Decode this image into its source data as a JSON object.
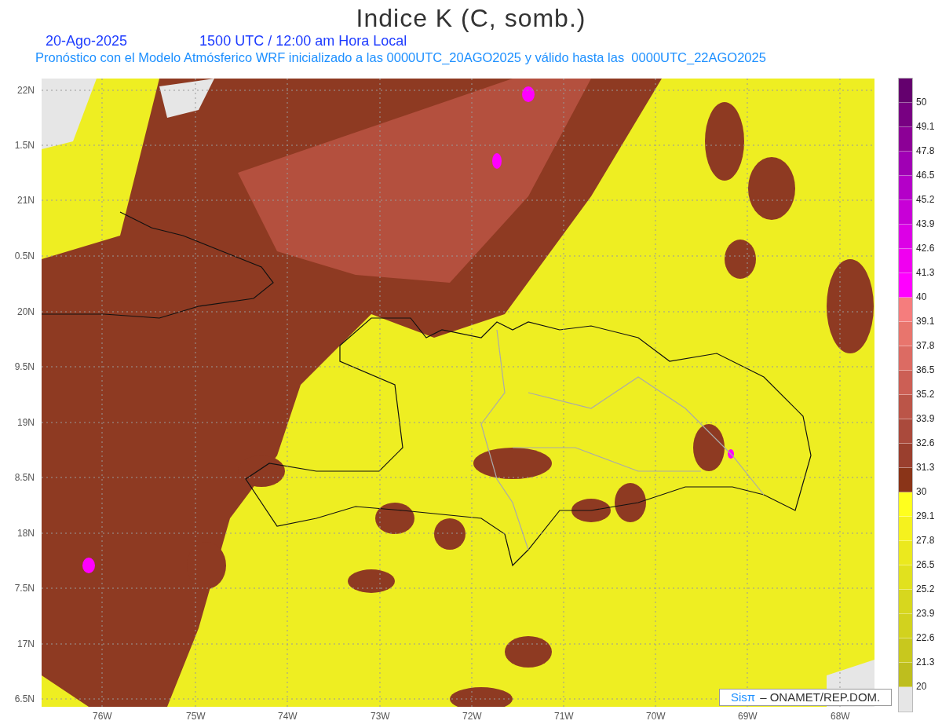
{
  "title": "Indice K (C, somb.)",
  "date": "20-Ago-2025",
  "time": "1500 UTC / 12:00 am Hora Local",
  "subtitle": "Pronóstico con el Modelo Atmósferico WRF inicializado a las 0000UTC_20AGO2025 y válido hasta las  0000UTC_22AGO2025",
  "lat_labels": [
    "22N",
    "1.5N",
    "21N",
    "0.5N",
    "20N",
    "9.5N",
    "19N",
    "8.5N",
    "18N",
    "7.5N",
    "17N",
    "6.5N"
  ],
  "lon_labels": [
    "76W",
    "75W",
    "74W",
    "73W",
    "72W",
    "71W",
    "70W",
    "69W",
    "68W"
  ],
  "colorbar": {
    "boxes": [
      {
        "color": "#64006e"
      },
      {
        "color": "#780082"
      },
      {
        "color": "#8c0096"
      },
      {
        "color": "#a000b4"
      },
      {
        "color": "#b400c8"
      },
      {
        "color": "#c800d7"
      },
      {
        "color": "#dc00e6"
      },
      {
        "color": "#f000f0"
      },
      {
        "color": "#ff00ff"
      },
      {
        "color": "#f57d7d"
      },
      {
        "color": "#e8756d"
      },
      {
        "color": "#dc6b63"
      },
      {
        "color": "#cc5f55"
      },
      {
        "color": "#bb5548"
      },
      {
        "color": "#aa4a3c"
      },
      {
        "color": "#9a3f2e"
      },
      {
        "color": "#8a3418"
      },
      {
        "color": "#ffff1e"
      },
      {
        "color": "#f5f21e"
      },
      {
        "color": "#ebe91e"
      },
      {
        "color": "#e1e11e"
      },
      {
        "color": "#d7d71e"
      },
      {
        "color": "#d2d21e"
      },
      {
        "color": "#c8c81e"
      },
      {
        "color": "#bebe1e"
      },
      {
        "color": "#e6e6e6"
      }
    ],
    "labels": [
      "50",
      "49.1",
      "47.8",
      "46.5",
      "45.2",
      "43.9",
      "42.6",
      "41.3",
      "40",
      "39.1",
      "37.8",
      "36.5",
      "35.2",
      "33.9",
      "32.6",
      "31.3",
      "30",
      "29.1",
      "27.8",
      "26.5",
      "25.2",
      "23.9",
      "22.6",
      "21.3",
      "20"
    ]
  },
  "credit": {
    "brand": "Sisπ",
    "text": "– ONAMET/REP.DOM."
  }
}
